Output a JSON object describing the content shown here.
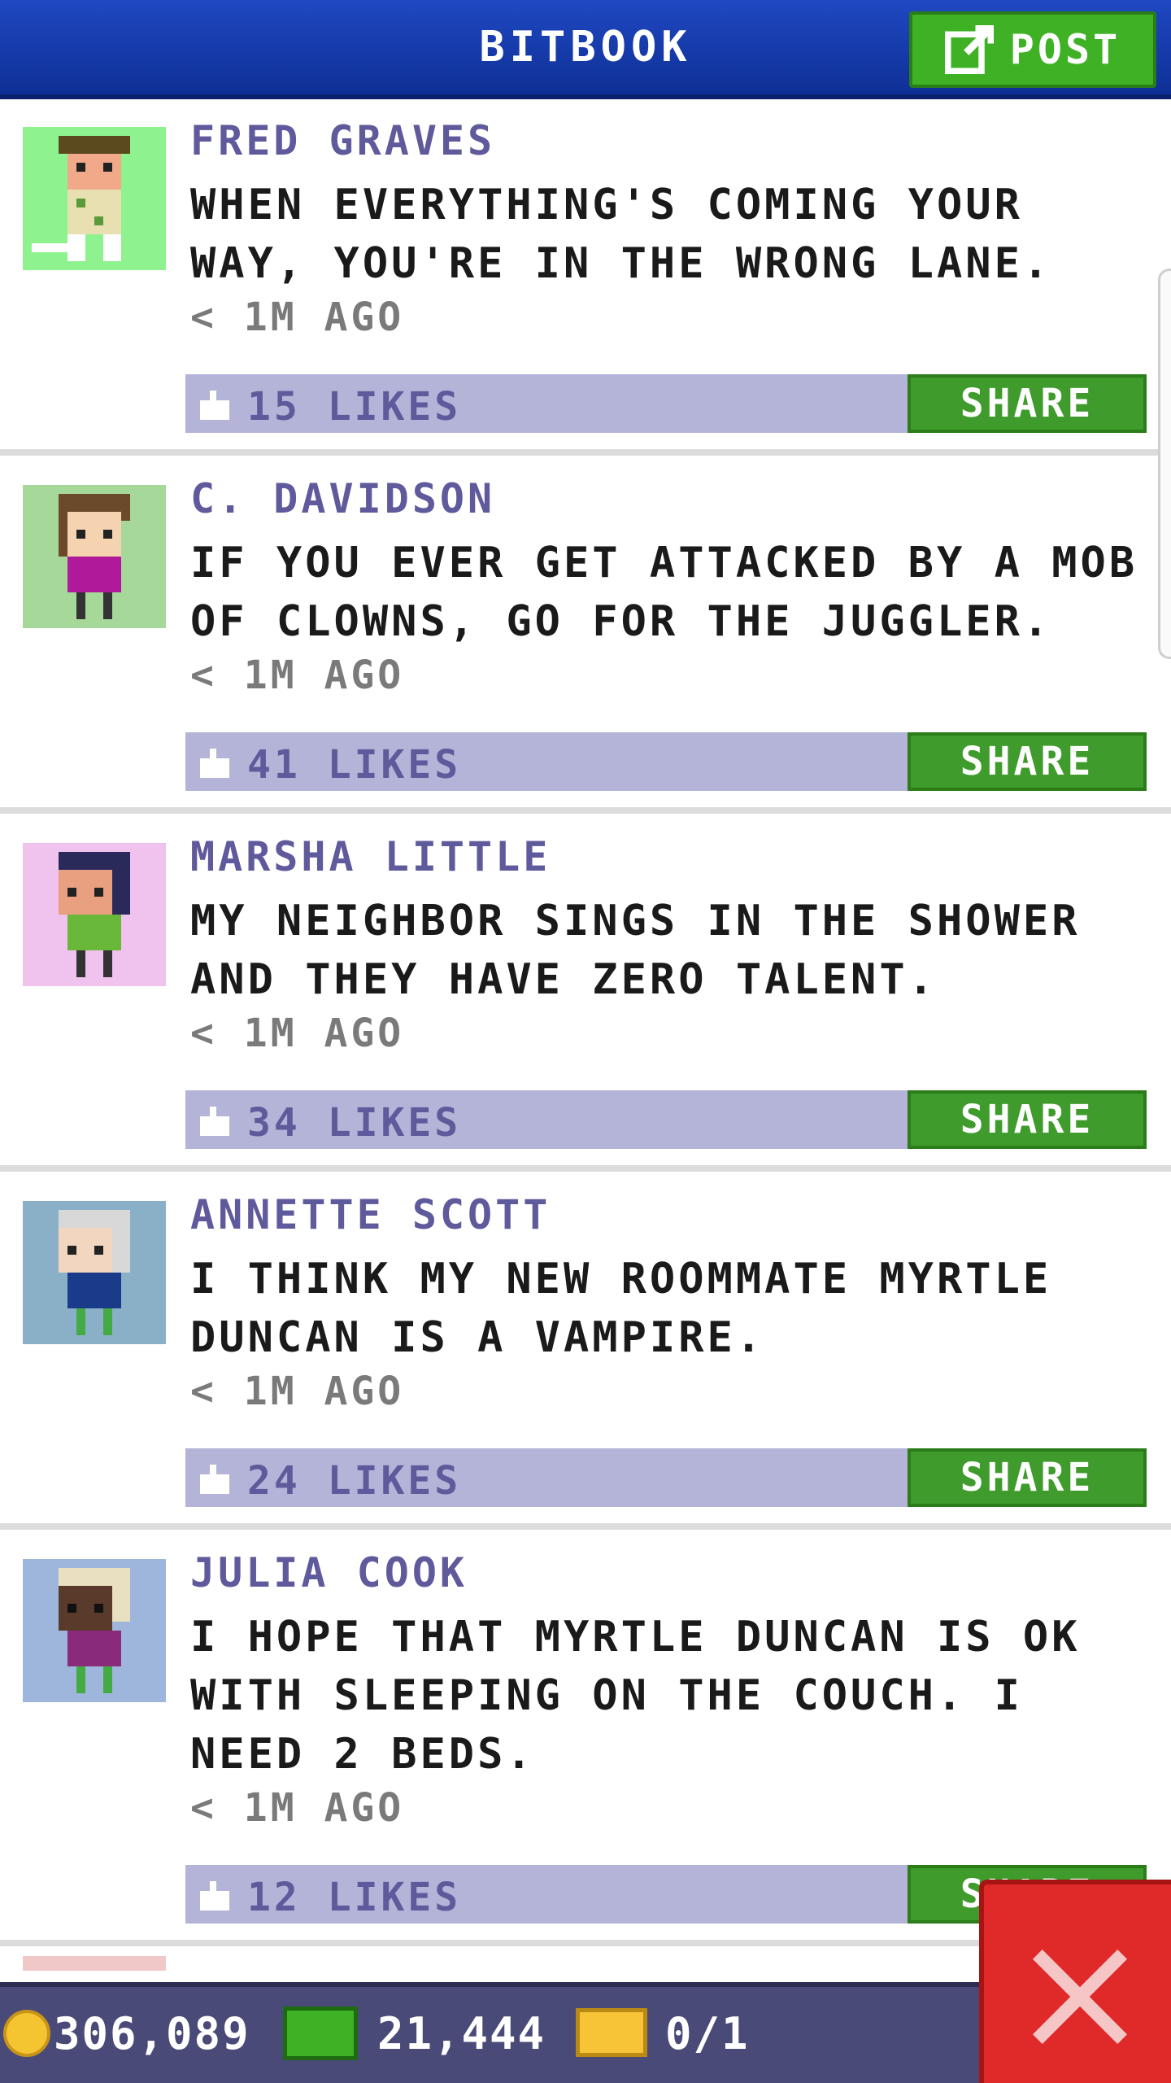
{
  "header": {
    "title": "BITBOOK",
    "post_label": "POST"
  },
  "posts": [
    {
      "author": "FRED GRAVES",
      "text": "WHEN EVERYTHING'S COMING YOUR WAY, YOU'RE IN THE WRONG LANE.",
      "time": "< 1M AGO",
      "likes": "15 LIKES",
      "share_label": "SHARE",
      "avatar_bg": "#8ef28e"
    },
    {
      "author": "C. DAVIDSON",
      "text": "IF YOU EVER GET ATTACKED BY A MOB OF CLOWNS, GO FOR THE JUGGLER.",
      "time": "< 1M AGO",
      "likes": "41 LIKES",
      "share_label": "SHARE",
      "avatar_bg": "#a6d89a"
    },
    {
      "author": "MARSHA LITTLE",
      "text": "MY NEIGHBOR SINGS IN THE SHOWER AND THEY HAVE ZERO TALENT.",
      "time": "< 1M AGO",
      "likes": "34 LIKES",
      "share_label": "SHARE",
      "avatar_bg": "#f0c2ee"
    },
    {
      "author": "ANNETTE SCOTT",
      "text": "I THINK MY NEW ROOMMATE MYRTLE DUNCAN IS A VAMPIRE.",
      "time": "< 1M AGO",
      "likes": "24 LIKES",
      "share_label": "SHARE",
      "avatar_bg": "#8ab0c8"
    },
    {
      "author": "JULIA COOK",
      "text": "I HOPE THAT MYRTLE DUNCAN IS OK WITH SLEEPING ON THE COUCH. I NEED 2 BEDS.",
      "time": "< 1M AGO",
      "likes": "12 LIKES",
      "share_label": "SHARE",
      "avatar_bg": "#9fb6dc"
    }
  ],
  "footer": {
    "coins": "306,089",
    "bux": "21,444",
    "tickets": "0/1"
  },
  "colors": {
    "header": "#1f48c2",
    "likes_bar": "#b3b4d7",
    "share_button": "#3f9c2c",
    "close_button": "#e02a2a"
  }
}
